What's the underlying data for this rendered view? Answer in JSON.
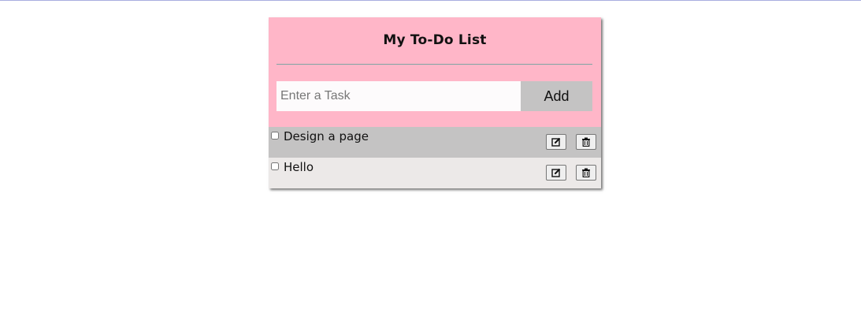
{
  "header": {
    "title": "My To-Do List"
  },
  "input": {
    "placeholder": "Enter a Task",
    "value": ""
  },
  "add_button": {
    "label": "Add"
  },
  "tasks": [
    {
      "label": "Design a page",
      "checked": false,
      "edit_icon": "edit-icon",
      "delete_icon": "trash-icon"
    },
    {
      "label": "Hello",
      "checked": false,
      "edit_icon": "edit-icon",
      "delete_icon": "trash-icon"
    }
  ],
  "colors": {
    "header_bg": "#ffb6c8",
    "row_1_bg": "#c4c3c3",
    "row_2_bg": "#ece9e8",
    "add_button_bg": "#c4c3c3"
  }
}
